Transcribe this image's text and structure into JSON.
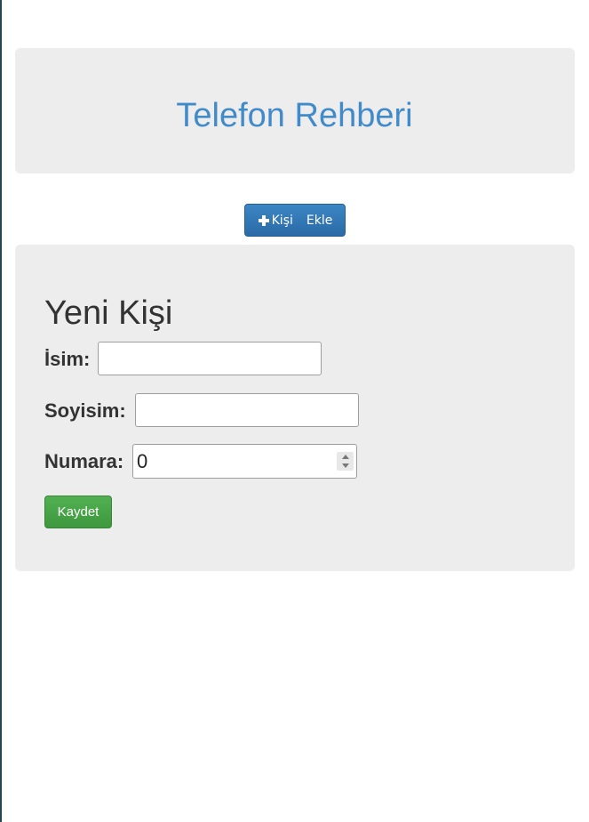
{
  "header": {
    "title": "Telefon Rehberi"
  },
  "toolbar": {
    "add_icon": "plus-icon",
    "add_label_part1": "Kişi",
    "add_label_part2": "Ekle"
  },
  "form": {
    "title": "Yeni Kişi",
    "name_label": "İsim:",
    "name_value": "",
    "surname_label": "Soyisim:",
    "surname_value": "",
    "number_label": "Numara:",
    "number_value": "0",
    "save_label": "Kaydet"
  },
  "colors": {
    "title_blue": "#428bca",
    "primary_button": "#2a6aa6",
    "success_button": "#44a044",
    "panel_background": "#ededed"
  }
}
